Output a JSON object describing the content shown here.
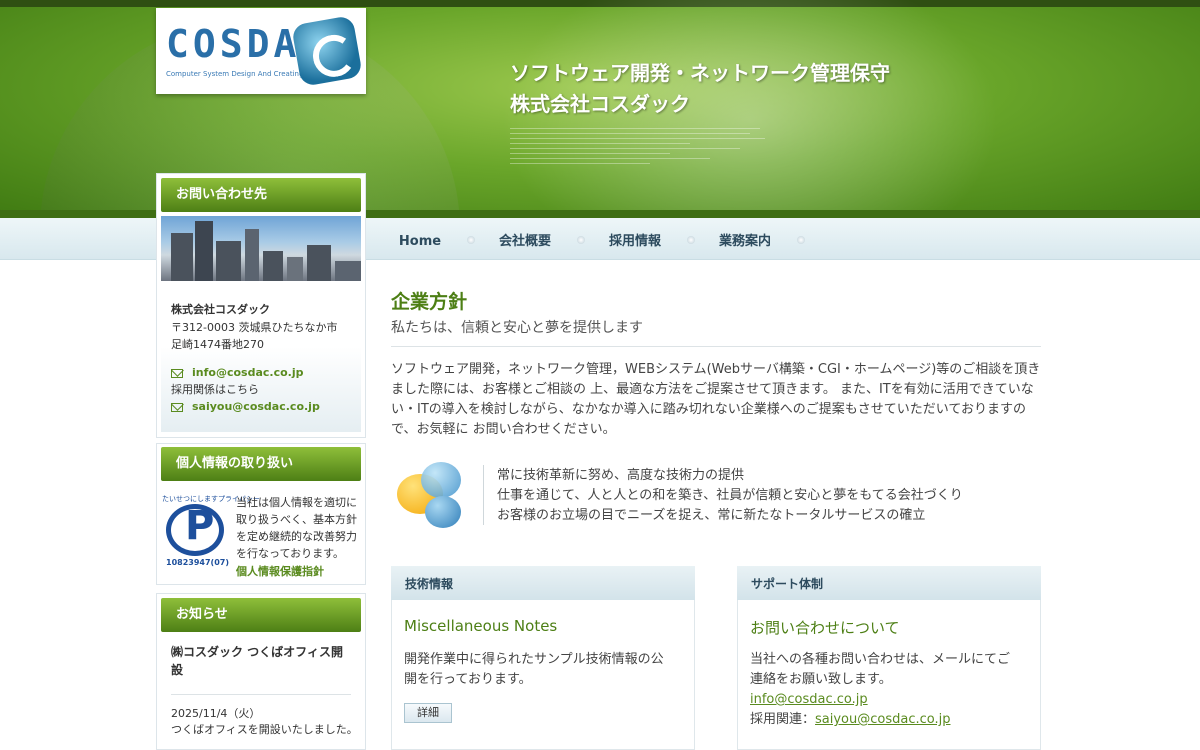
{
  "header": {
    "logo_text": "COSDAC",
    "logo_subtitle": "Computer System Design And Creating",
    "tagline_line1": "ソフトウェア開発・ネットワーク管理保守",
    "tagline_line2": "株式会社コスダック"
  },
  "nav": {
    "items": [
      {
        "label": "Home"
      },
      {
        "label": "会社概要"
      },
      {
        "label": "採用情報"
      },
      {
        "label": "業務案内"
      }
    ]
  },
  "sidebar": {
    "contact": {
      "heading": "お問い合わせ先",
      "company": "株式会社コスダック",
      "postal": "〒312-0003 茨城県ひたちなか市",
      "address": "足崎1474番地270",
      "email": "info@cosdac.co.jp",
      "recruit_note": "採用関係はこちら",
      "recruit_email": "saiyou@cosdac.co.jp"
    },
    "privacy": {
      "heading": "個人情報の取り扱い",
      "mark_arc": "たいせつにしますプライバシー",
      "mark_number": "10823947(07)",
      "text": "当社は個人情報を適切に取り扱うべく、基本方針を定め継続的な改善努力を行なっております。",
      "link": "個人情報保護指針"
    },
    "news": {
      "heading": "お知らせ",
      "item_title": "㈱コスダック つくばオフィス開設",
      "item_date": "2025/11/4（火）",
      "item_body": "つくばオフィスを開設いたしました。"
    }
  },
  "main": {
    "title": "企業方針",
    "subtitle": "私たちは、信頼と安心と夢を提供します",
    "intro": "ソフトウェア開発，ネットワーク管理，WEBシステム(Webサーバ構築・CGI・ホームページ)等のご相談を頂きました際には、お客様とご相談の 上、最適な方法をご提案させて頂きます。 また、ITを有効に活用できていない・ITの導入を検討しながら、なかなか導入に踏み切れない企業様へのご提案もさせていただいておりますので、お気軽に お問い合わせください。",
    "policies": [
      "常に技術革新に努め、高度な技術力の提供",
      "仕事を通じて、人と人との和を築き、社員が信頼と安心と夢をもてる会社づくり",
      "お客様のお立場の目でニーズを捉え、常に新たなトータルサービスの確立"
    ],
    "tech_card": {
      "heading": "技術情報",
      "title": "Miscellaneous Notes",
      "text": "開発作業中に得られたサンプル技術情報の公開を行っております。",
      "button": "詳細"
    },
    "support_card": {
      "heading": "サポート体制",
      "title": "お問い合わせについて",
      "text": "当社への各種お問い合わせは、メールにてご連絡をお願い致します。",
      "email": "info@cosdac.co.jp",
      "recruit_label": "採用関連：",
      "recruit_email": "saiyou@cosdac.co.jp"
    }
  },
  "colors": {
    "brand_green": "#4d7f15",
    "link_green": "#5a8b1f",
    "nav_text": "#2d4b5e",
    "logo_blue": "#2a6fa8"
  }
}
